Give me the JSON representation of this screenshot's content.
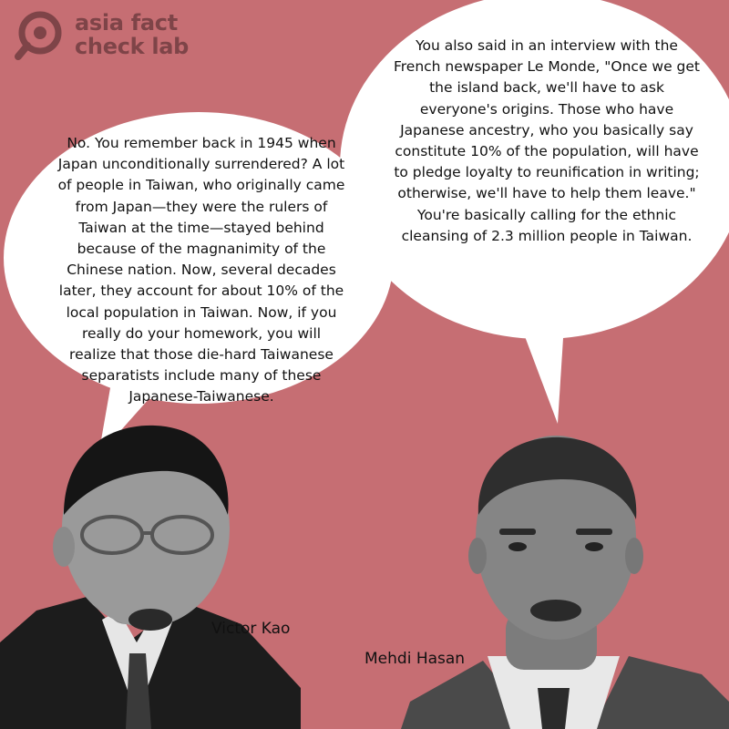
{
  "brand": {
    "name_line1": "asia fact",
    "name_line2": "check lab",
    "logo_icon": "magnifier-icon",
    "colors": {
      "background": "#c66e73",
      "logo": "#7e4448",
      "bubble": "#ffffff"
    }
  },
  "quotes": {
    "left": "No. You remember back in 1945 when Japan unconditionally surrendered? A lot of people in Taiwan, who originally came from Japan—they were the rulers of Taiwan at the time—stayed behind because of the magnanimity of the Chinese nation. Now, several decades later, they account for about 10% of the local population in Taiwan. Now, if you really do your homework, you will realize that those die-hard Taiwanese separatists include many of these Japanese-Taiwanese.",
    "right": "You also said in an interview with the French newspaper Le Monde, \"Once we get the island back, we'll have to ask everyone's origins. Those who have Japanese ancestry, who you basically say constitute 10% of the population, will have to pledge loyalty to reunification in writing; otherwise, we'll have to help them leave.\" You're basically calling for the ethnic cleansing of 2.3 million people in Taiwan."
  },
  "speakers": {
    "left": "Victor Kao",
    "right": "Mehdi Hasan"
  }
}
